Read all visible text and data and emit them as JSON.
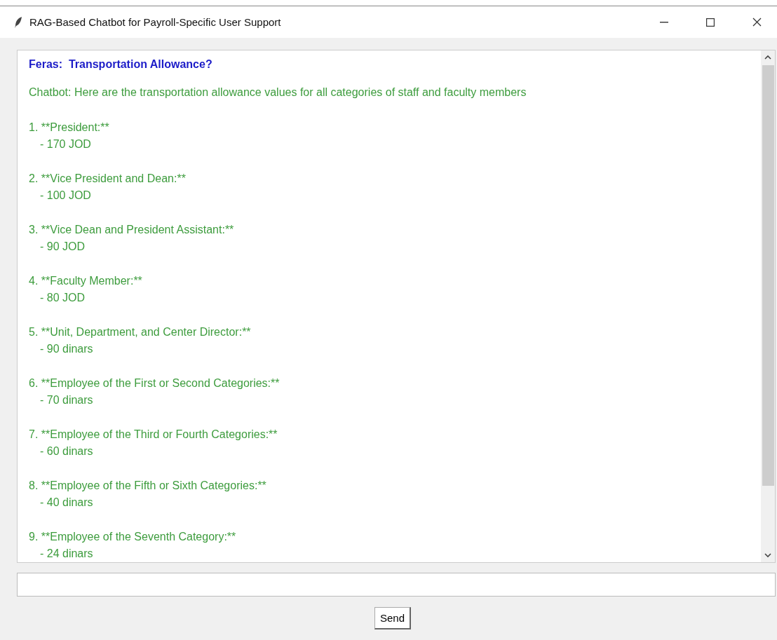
{
  "window": {
    "title": "RAG-Based Chatbot for Payroll-Specific User Support"
  },
  "messages": [
    {
      "kind": "user",
      "text": "Feras:  Transportation Allowance?"
    },
    {
      "kind": "bot",
      "text": "Chatbot: Here are the transportation allowance values for all categories of staff and faculty members"
    }
  ],
  "list_items": [
    {
      "heading": "1. **President:**",
      "value": "- 170 JOD"
    },
    {
      "heading": "2. **Vice President and Dean:**",
      "value": "- 100 JOD"
    },
    {
      "heading": "3. **Vice Dean and President Assistant:**",
      "value": "- 90 JOD"
    },
    {
      "heading": "4. **Faculty Member:**",
      "value": "- 80 JOD"
    },
    {
      "heading": "5. **Unit, Department, and Center Director:**",
      "value": "- 90 dinars"
    },
    {
      "heading": "6. **Employee of the First or Second Categories:**",
      "value": "- 70 dinars"
    },
    {
      "heading": "7. **Employee of the Third or Fourth Categories:**",
      "value": "- 60 dinars"
    },
    {
      "heading": "8. **Employee of the Fifth or Sixth Categories:**",
      "value": "- 40 dinars"
    },
    {
      "heading": "9. **Employee of the Seventh Category:**",
      "value": "- 24 dinars"
    }
  ],
  "send_button": {
    "label": "Send"
  }
}
